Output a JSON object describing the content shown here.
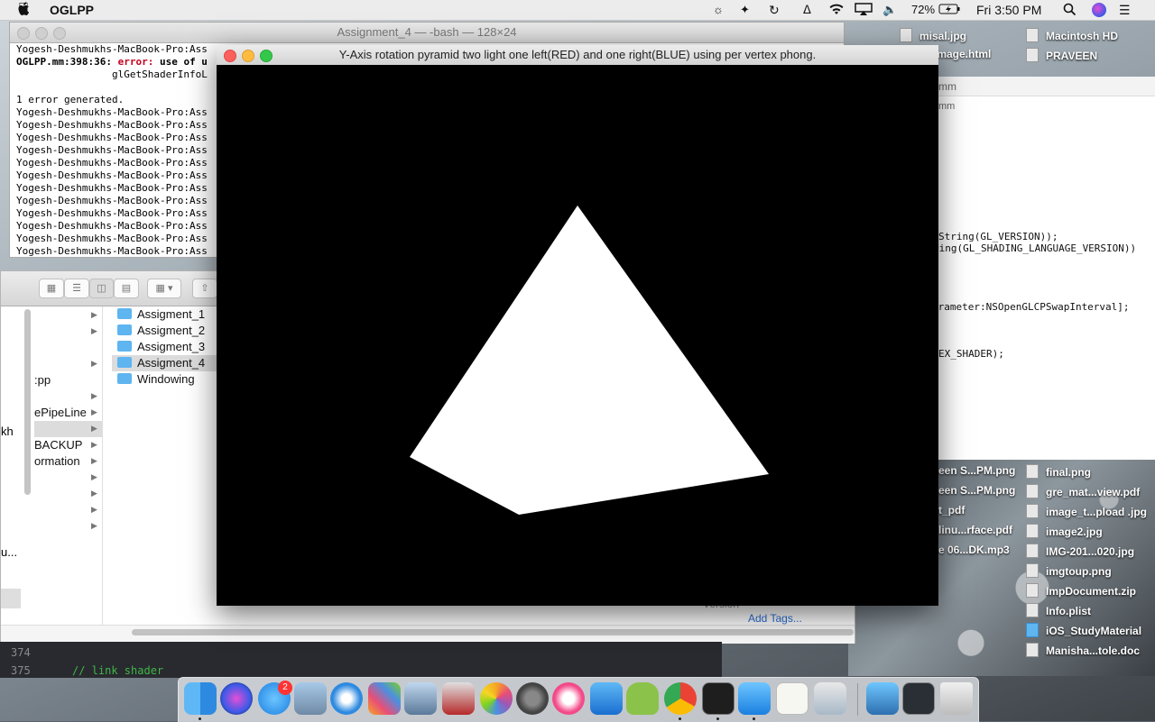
{
  "menubar": {
    "app_name": "OGLPP",
    "battery": "72%",
    "clock": "Fri 3:50 PM"
  },
  "desktop": {
    "right_icons": [
      {
        "label": "misal.jpg"
      },
      {
        "label": "Macintosh HD"
      },
      {
        "label": "image.html"
      },
      {
        "label": "PRAVEEN"
      },
      {
        "label": "een S...PM.png"
      },
      {
        "label": "final.png"
      },
      {
        "label": "een S...PM.png"
      },
      {
        "label": "gre_mat...view.pdf"
      },
      {
        "label": "t_pdf"
      },
      {
        "label": "image_t...pload .jpg"
      },
      {
        "label": "linu...rface.pdf"
      },
      {
        "label": "image2.jpg"
      },
      {
        "label": "e 06...DK.mp3"
      },
      {
        "label": "IMG-201...020.jpg"
      },
      {
        "label": "imgtoup.png"
      },
      {
        "label": "ImpDocument.zip"
      },
      {
        "label": "Info.plist"
      },
      {
        "label": "iOS_StudyMaterial"
      },
      {
        "label": "Manisha...tole.doc"
      }
    ]
  },
  "editor": {
    "tab_name": "mm",
    "lines": [
      "String(GL_VERSION));",
      "ring(GL_SHADING_LANGUAGE_VERSION))",
      "arameter:NSOpenGLCPSwapInterval];",
      "EX_SHADER);"
    ]
  },
  "terminal": {
    "title": "Assignment_4 — -bash — 128×24",
    "prompt_text": "Yogesh-Deshmukhs-MacBook-Pro:Ass",
    "error_file": "OGLPP.mm:398:36: ",
    "error_label": "error: ",
    "error_msg": "use of u",
    "error_cont": "                glGetShaderInfoL",
    "summary": "1 error generated."
  },
  "finder": {
    "col1_items": [
      "",
      "",
      "",
      "",
      ":pp",
      "",
      "ePipeLine",
      "",
      "BACKUP",
      "ormation",
      "",
      "",
      "",
      "",
      ""
    ],
    "left_edge": [
      "kh",
      "u..."
    ],
    "folders": [
      "Assigment_1",
      "Assigment_2",
      "Assigment_3",
      "Assigment_4",
      "Windowing"
    ],
    "selected_index": 3,
    "add_tags": "Add Tags...",
    "version_label": "Version"
  },
  "code": {
    "line_374": "374",
    "line_375": "375",
    "comment": "// link shader"
  },
  "glwindow": {
    "title": "Y-Axis rotation pyramid two light one left(RED) and one right(BLUE) using per vertex phong."
  },
  "dock": {
    "badge_count": "2",
    "apps": [
      "finder-icon",
      "siri-icon",
      "app-store-icon",
      "preview-icon",
      "safari-icon",
      "launchpad-icon",
      "image-capture-icon",
      "photo-booth-icon",
      "photos-icon",
      "system-preferences-icon",
      "itunes-icon",
      "xcode-docs-icon",
      "android-icon",
      "chrome-icon",
      "terminal-icon",
      "xcode-icon",
      "textedit-icon",
      "instruments-icon",
      "xcode-folder-icon",
      "screen-icon",
      "trash-icon"
    ]
  }
}
